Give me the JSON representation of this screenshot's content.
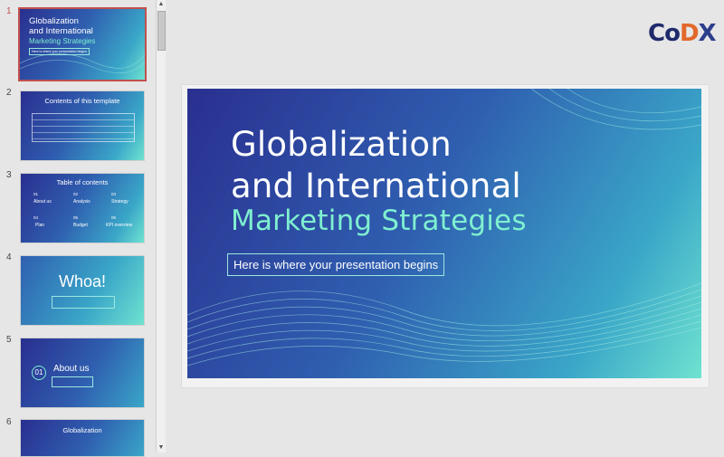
{
  "logo": {
    "parts": [
      "Co",
      "D",
      "X"
    ]
  },
  "slides": [
    {
      "num": "1",
      "title_l1": "Globalization",
      "title_l2": "and International",
      "title_l3": "Marketing Strategies",
      "subtitle": "Here is where your presentation begins"
    },
    {
      "num": "2",
      "title": "Contents of this template"
    },
    {
      "num": "3",
      "title": "Table of contents",
      "items": [
        "About us",
        "Analysis",
        "Strategy",
        "Plan",
        "Budget",
        "KPI overview"
      ],
      "nums": [
        "01",
        "02",
        "03",
        "04",
        "05",
        "06"
      ]
    },
    {
      "num": "4",
      "title": "Whoa!"
    },
    {
      "num": "5",
      "badge": "01",
      "title": "About us"
    },
    {
      "num": "6",
      "title": "Globalization"
    }
  ],
  "main": {
    "title_l1": "Globalization",
    "title_l2": "and International",
    "title_l3": "Marketing Strategies",
    "subtitle": "Here is where your presentation begins"
  }
}
